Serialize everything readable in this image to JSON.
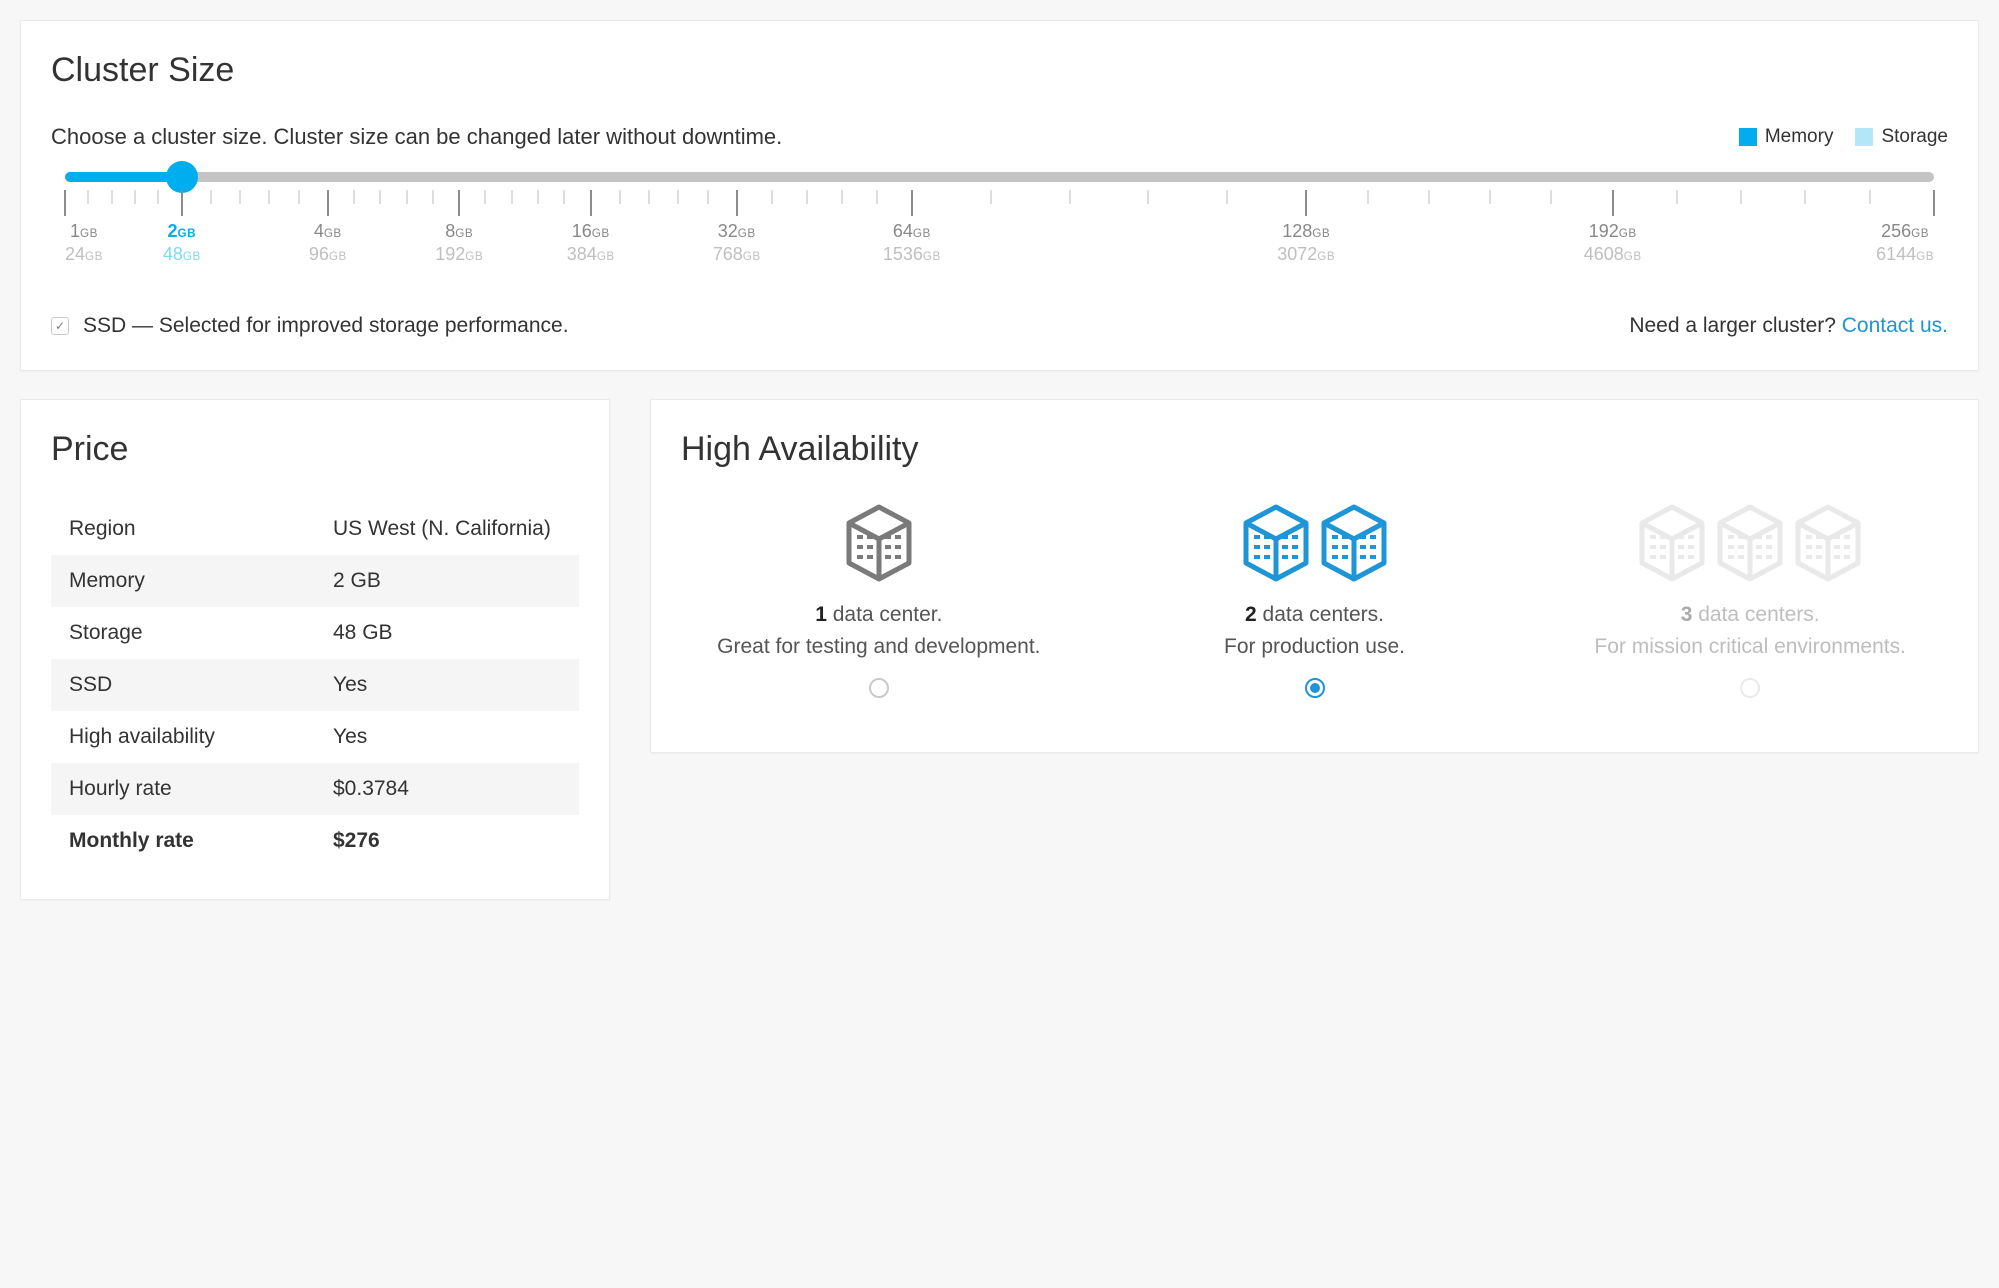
{
  "cluster": {
    "title": "Cluster Size",
    "description": "Choose a cluster size. Cluster size can be changed later without downtime.",
    "legend_memory": "Memory",
    "legend_storage": "Storage",
    "selected_index": 1,
    "stops": [
      {
        "memory": "1",
        "storage": "24",
        "pos": 0.0
      },
      {
        "memory": "2",
        "storage": "48",
        "pos": 0.0625
      },
      {
        "memory": "4",
        "storage": "96",
        "pos": 0.1406
      },
      {
        "memory": "8",
        "storage": "192",
        "pos": 0.2109
      },
      {
        "memory": "16",
        "storage": "384",
        "pos": 0.2813
      },
      {
        "memory": "32",
        "storage": "768",
        "pos": 0.3594
      },
      {
        "memory": "64",
        "storage": "1536",
        "pos": 0.4531
      },
      {
        "memory": "128",
        "storage": "3072",
        "pos": 0.6641
      },
      {
        "memory": "192",
        "storage": "4608",
        "pos": 0.8281
      },
      {
        "memory": "256",
        "storage": "6144",
        "pos": 1.0
      }
    ],
    "ssd_checked": true,
    "ssd_label": "SSD — Selected for improved storage performance.",
    "larger_text": "Need a larger cluster? ",
    "larger_link": "Contact us."
  },
  "price": {
    "title": "Price",
    "rows": [
      {
        "label": "Region",
        "value": "US West (N. California)"
      },
      {
        "label": "Memory",
        "value": "2 GB"
      },
      {
        "label": "Storage",
        "value": "48 GB"
      },
      {
        "label": "SSD",
        "value": "Yes"
      },
      {
        "label": "High availability",
        "value": "Yes"
      },
      {
        "label": "Hourly rate",
        "value": "$0.3784"
      },
      {
        "label": "Monthly rate",
        "value": "$276",
        "bold": true
      }
    ]
  },
  "ha": {
    "title": "High Availability",
    "options": [
      {
        "count": "1",
        "label_suffix": " data center.",
        "caption": "Great for testing and development.",
        "selected": false,
        "disabled": false,
        "color": "#7a7a7a"
      },
      {
        "count": "2",
        "label_suffix": " data centers.",
        "caption": "For production use.",
        "selected": true,
        "disabled": false,
        "color": "#1e95d6"
      },
      {
        "count": "3",
        "label_suffix": " data centers.",
        "caption": "For mission critical environments.",
        "selected": false,
        "disabled": true,
        "color": "#c6c6c6"
      }
    ]
  },
  "unit_gb": "GB",
  "colors": {
    "accent": "#00aeef"
  }
}
